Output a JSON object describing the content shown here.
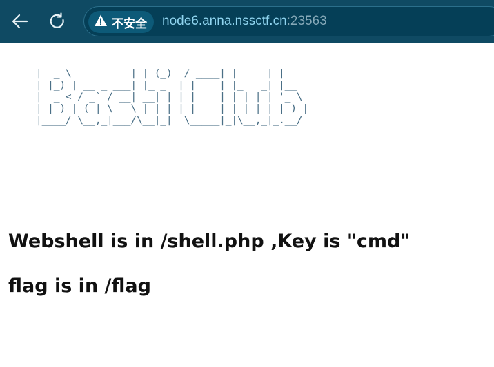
{
  "browser": {
    "security_label": "不安全",
    "url_host": "node6.anna.nssctf.cn",
    "url_port": ":23563",
    "icons": {
      "back": "back-arrow-icon",
      "reload": "reload-icon",
      "warning": "warning-triangle-icon"
    },
    "colors": {
      "toolbar": "#0f4a63",
      "omnibox": "#053f57",
      "url_host": "#8fd4ef"
    }
  },
  "page": {
    "ascii_art": " ____            _   _    _____ _       _     \n|  _ \\          | | (_)  / ____| |     | |    \n| |_) | __ _ ___| |_ _  | |    | |_   _| |__  \n|  _ < / _` / __| __| | | |    | | | | | '_ \\ \n| |_) | (_| \\__ \\ |_| | | |____| | |_| | |_) |\n|____/ \\__,_|___/\\__|_|  \\_____|_|\\__,_|_.__/ ",
    "message_1": "Webshell is in /shell.php ,Key is \"cmd\"",
    "message_2": "flag is in /flag"
  }
}
